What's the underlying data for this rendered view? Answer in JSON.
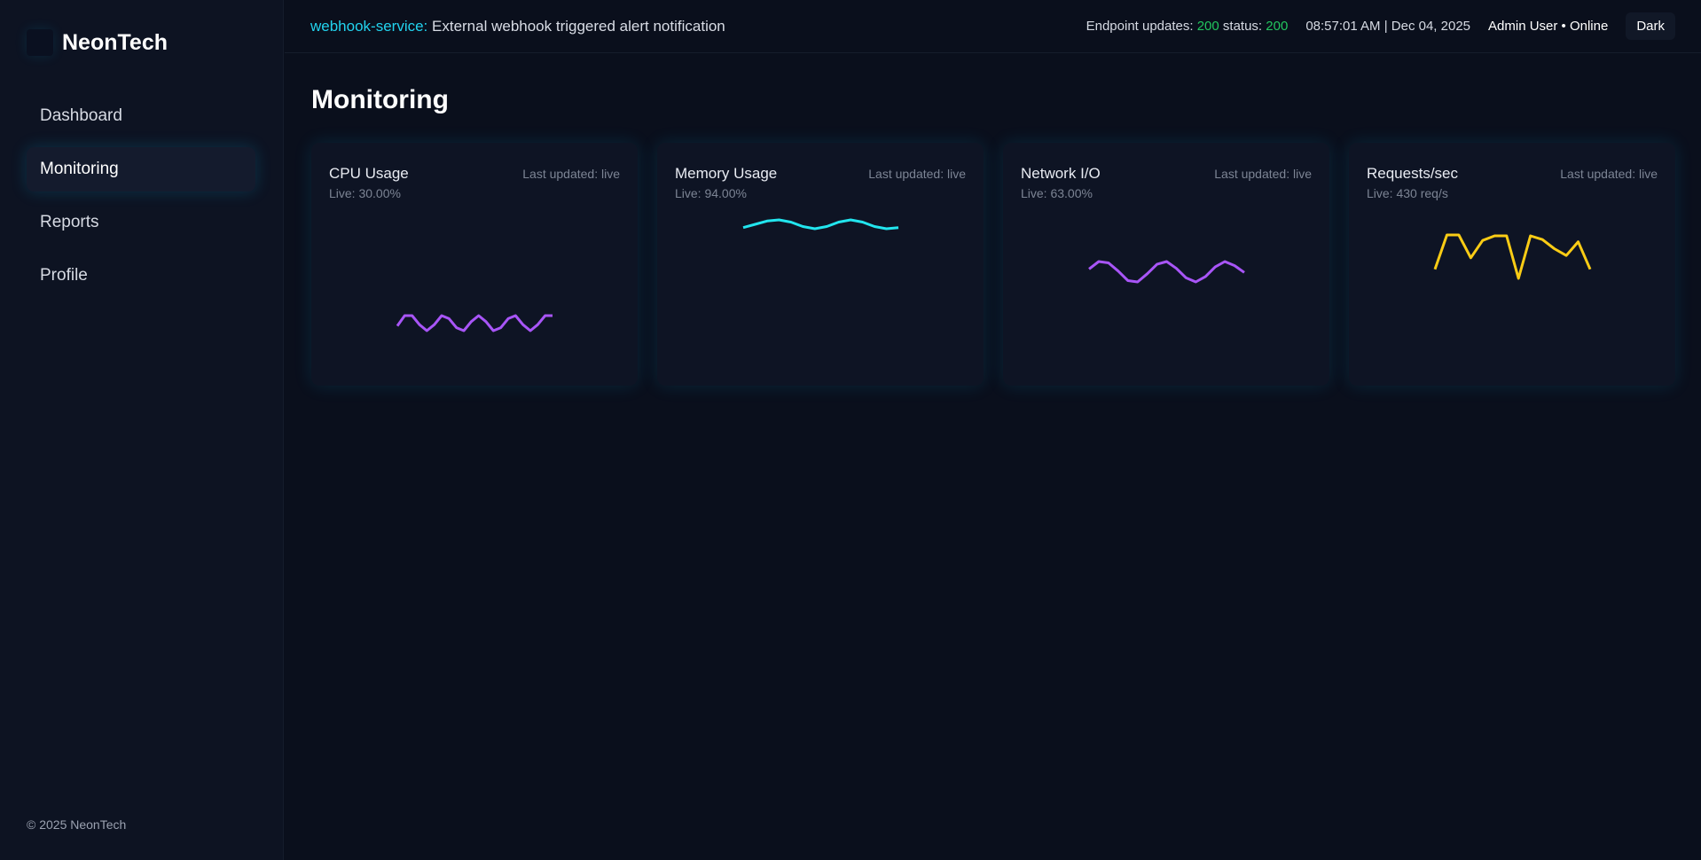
{
  "brand": {
    "name": "NeonTech",
    "footer": "© 2025 NeonTech"
  },
  "nav": [
    {
      "label": "Dashboard"
    },
    {
      "label": "Monitoring",
      "active": true
    },
    {
      "label": "Reports"
    },
    {
      "label": "Profile"
    }
  ],
  "header": {
    "alert_service": "webhook-service:",
    "alert_text": " External webhook triggered alert notification",
    "endpoint_label": "Endpoint updates: ",
    "endpoint_value": "200",
    "status_label": " status: ",
    "status_value": "200",
    "datetime": "08:57:01 AM | Dec 04, 2025",
    "user": "Admin User • Online",
    "theme": "Dark"
  },
  "page": {
    "title": "Monitoring"
  },
  "cards": [
    {
      "title": "CPU Usage",
      "live": "Live: 30.00%",
      "updated": "Last updated: live",
      "color": "#a855f7",
      "values": [
        29.3,
        31,
        31,
        29.5,
        28.5,
        29.5,
        31,
        30.5,
        29,
        28.5,
        30,
        31,
        30,
        28.5,
        29,
        30.5,
        31,
        29.5,
        28.5,
        29.5,
        31,
        31
      ]
    },
    {
      "title": "Memory Usage",
      "live": "Live: 94.00%",
      "updated": "Last updated: live",
      "color": "#22e5ee",
      "values": [
        93.7,
        94,
        94.3,
        94.4,
        94.2,
        93.8,
        93.6,
        93.8,
        94.2,
        94.4,
        94.2,
        93.8,
        93.6,
        93.7
      ]
    },
    {
      "title": "Network I/O",
      "live": "Live: 63.00%",
      "updated": "Last updated: live",
      "color": "#a855f7",
      "values": [
        63.3,
        64.4,
        64.2,
        63,
        61.6,
        61.4,
        62.6,
        64,
        64.4,
        63.4,
        62,
        61.4,
        62.2,
        63.6,
        64.4,
        63.8,
        62.8
      ]
    },
    {
      "title": "Requests/sec",
      "live": "Live: 430 req/s",
      "updated": "Last updated: live",
      "color": "#facc15",
      "values": [
        395,
        470,
        470,
        420,
        458,
        468,
        468,
        375,
        468,
        460,
        440,
        425,
        455,
        395
      ]
    }
  ]
}
